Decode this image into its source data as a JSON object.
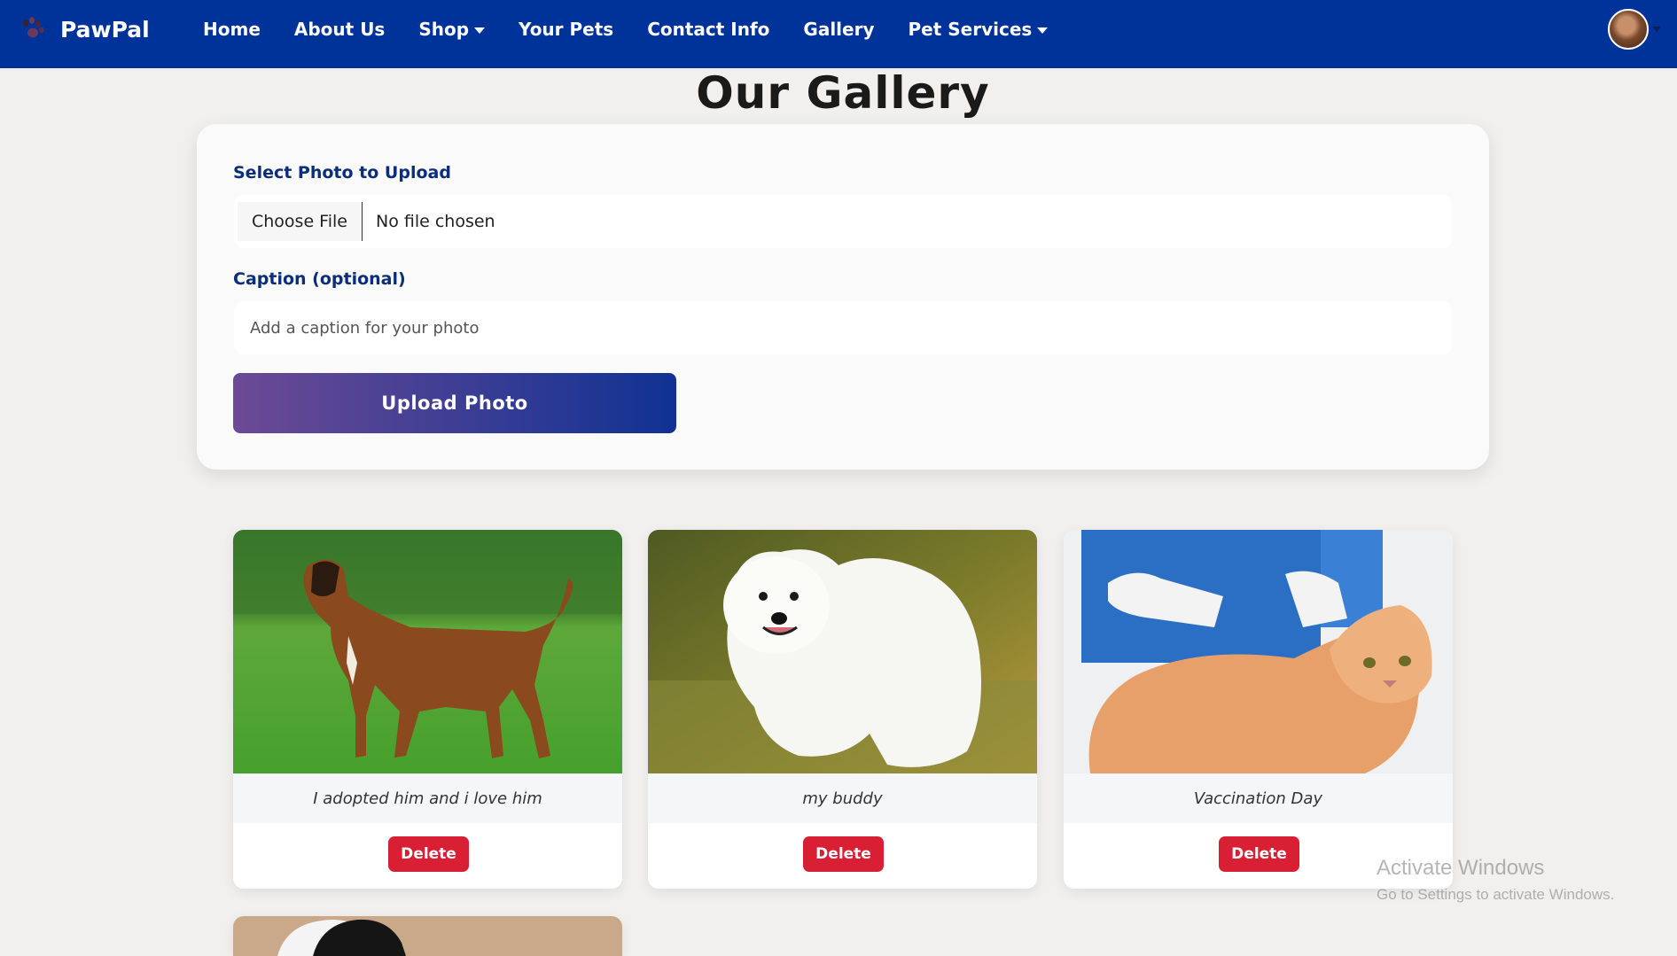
{
  "navbar": {
    "brand": "PawPal",
    "brand_icon": "paw-icon",
    "links": [
      {
        "label": "Home",
        "dropdown": false
      },
      {
        "label": "About Us",
        "dropdown": false
      },
      {
        "label": "Shop",
        "dropdown": true
      },
      {
        "label": "Your Pets",
        "dropdown": false
      },
      {
        "label": "Contact Info",
        "dropdown": false
      },
      {
        "label": "Gallery",
        "dropdown": false
      },
      {
        "label": "Pet Services",
        "dropdown": true
      }
    ],
    "bg_color": "#00339a"
  },
  "page": {
    "title": "Our Gallery"
  },
  "upload_form": {
    "photo_label": "Select Photo to Upload",
    "choose_file": "Choose File",
    "file_status": "No file chosen",
    "caption_label": "Caption (optional)",
    "caption_placeholder": "Add a caption for your photo",
    "caption_value": "",
    "submit_label": "Upload Photo"
  },
  "gallery": [
    {
      "caption": "I adopted him and i love him",
      "delete_label": "Delete",
      "photo": "boxer-dog-on-grass"
    },
    {
      "caption": "my buddy",
      "delete_label": "Delete",
      "photo": "white-samoyed-dog"
    },
    {
      "caption": "Vaccination Day",
      "delete_label": "Delete",
      "photo": "cat-receiving-vaccine"
    },
    {
      "caption": "",
      "delete_label": "",
      "photo": "black-white-pet-partial"
    }
  ],
  "watermark": {
    "title": "Activate Windows",
    "subtitle": "Go to Settings to activate Windows."
  },
  "colors": {
    "delete": "#d81f34",
    "label": "#0b2e7a",
    "upload_gradient_start": "#6c4a95",
    "upload_gradient_end": "#103293"
  }
}
